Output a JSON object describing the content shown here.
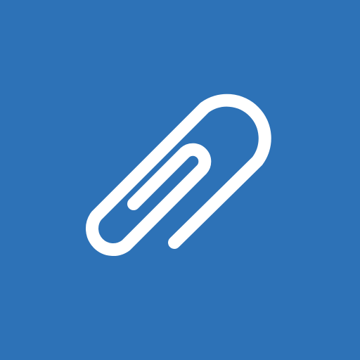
{
  "icon": {
    "name": "paperclip-icon",
    "background_color": "#2d72b7",
    "glyph_color": "#ffffff"
  }
}
